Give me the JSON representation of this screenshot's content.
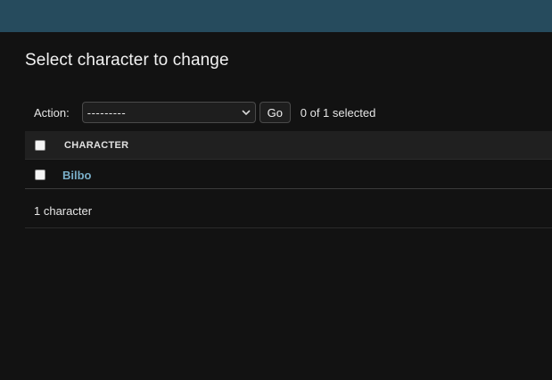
{
  "page": {
    "title": "Select character to change"
  },
  "actions": {
    "label": "Action:",
    "selected_option": "---------",
    "go_label": "Go",
    "selected_count": "0 of 1 selected"
  },
  "table": {
    "columns": [
      "CHARACTER"
    ],
    "rows": [
      {
        "name": "Bilbo"
      }
    ]
  },
  "paginator": {
    "text": "1 character"
  },
  "colors": {
    "header_bar": "#264b5d",
    "background": "#121212",
    "link": "#79aec8"
  },
  "icons": {
    "select_arrow": "chevron-down-icon"
  }
}
